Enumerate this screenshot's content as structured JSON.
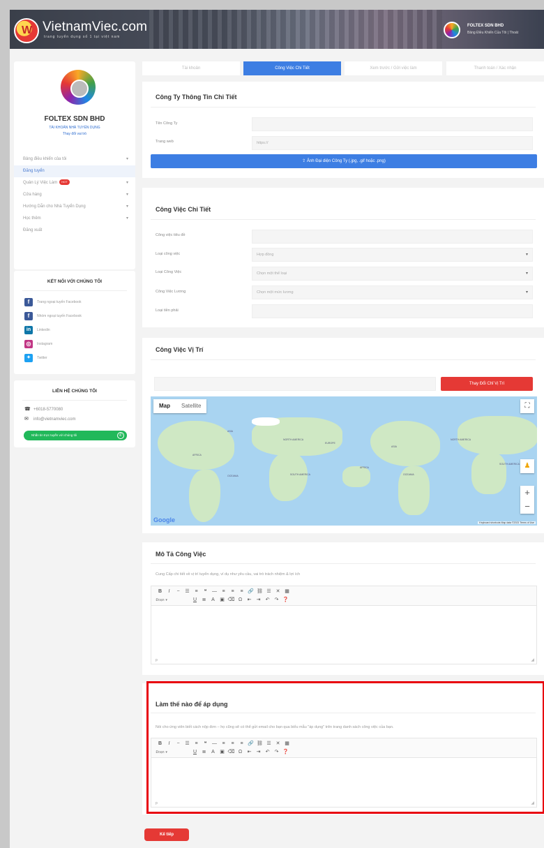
{
  "header": {
    "brand": "VietnamViec.com",
    "tagline": "trang tuyển dụng số 1 tại việt nam",
    "user_name": "FOLTEX SDN BHD",
    "user_links": "Bảng Điều Khiển Của Tôi  |  Thoát"
  },
  "profile": {
    "name": "FOLTEX SDN BHD",
    "account_type": "TÀI KHOẢN NHÀ TUYỂN DỤNG",
    "change_role": "Thay đổi vai trò"
  },
  "nav": {
    "items": [
      {
        "label": "Bảng điều khiển của tôi",
        "chevron": true
      },
      {
        "label": "Đăng tuyển",
        "active": true
      },
      {
        "label": "Quản Lý Việc Làm",
        "badge": "HOT",
        "chevron": true
      },
      {
        "label": "Cửa hàng",
        "chevron": true
      },
      {
        "label": "Hướng Dẫn cho Nhà Tuyển Dụng",
        "chevron": true
      },
      {
        "label": "Học thêm",
        "chevron": true
      },
      {
        "label": "Đăng xuất"
      }
    ]
  },
  "connect": {
    "title": "KẾT NỐI VỚI CHÚNG TÔI",
    "items": [
      {
        "label": "Trang ngoại tuyến Facebook",
        "icon": "facebook-icon",
        "color": "#3b5998"
      },
      {
        "label": "Nhóm ngoại tuyến Facebook",
        "icon": "facebook-icon",
        "color": "#3b5998"
      },
      {
        "label": "Linkedin",
        "icon": "linkedin-icon",
        "color": "#0e76a8"
      },
      {
        "label": "Instagram",
        "icon": "instagram-icon",
        "color": "#c13584"
      },
      {
        "label": "Twitter",
        "icon": "twitter-icon",
        "color": "#1da1f2"
      }
    ]
  },
  "contact": {
    "title": "LIÊN HỆ CHÚNG TÔI",
    "phone": "+6018-5770080",
    "email": "info@vietnamviec.com",
    "whatsapp_button": "Nhắn tin trực tuyến với chúng tôi"
  },
  "tabs": [
    "Tài khoản",
    "Công Việc Chi Tiết",
    "Xem trước / Gửi việc làm",
    "Thanh toán / Xác nhận"
  ],
  "company": {
    "title": "Công Ty Thông Tin Chi Tiết",
    "name_label": "Tên Công Ty",
    "name_value": "",
    "web_label": "Trang web",
    "web_placeholder": "https://",
    "upload_button": "Ảnh Đại diện Công Ty (.jpg, .gif hoặc .png)"
  },
  "job": {
    "title": "Công Việc Chi Tiết",
    "fields": [
      {
        "label": "Công việc tiêu đề",
        "value": "",
        "select": false
      },
      {
        "label": "Loại công việc",
        "value": "Hợp đồng",
        "select": true
      },
      {
        "label": "Loại Công Việc",
        "value": "Chọn một thể loại",
        "select": true
      },
      {
        "label": "Công Việc Lương",
        "value": "Chọn một mức lương",
        "select": true
      },
      {
        "label": "Loại tiền phải",
        "value": "",
        "select": false
      }
    ]
  },
  "location": {
    "title": "Công Việc Vị Trí",
    "input_value": "",
    "change_button": "Thay Đổi Chỉ Vị Trí",
    "map_tab": "Map",
    "satellite_tab": "Satellite",
    "google": "Google",
    "footer": "Keyboard shortcuts   Map data ©2021   Terms of Use"
  },
  "description": {
    "title": "Mô Tả Công Việc",
    "help": "Cung Cấp chi tiết về vị trí tuyển dụng, ví dụ như yêu cầu, vai trò trách nhiệm & lợi ích",
    "format": "Đoạn",
    "path": "p"
  },
  "apply": {
    "title": "Làm thế nào để áp dụng",
    "help": "Nói cho ứng viên biết cách nộp đơn – họ cũng sẽ có thể gửi email cho bạn qua biểu mẫu \"áp dụng\" trên trang danh sách công việc của bạn.",
    "format": "Đoạn",
    "path": "p"
  },
  "next_button": "Kế tiếp"
}
